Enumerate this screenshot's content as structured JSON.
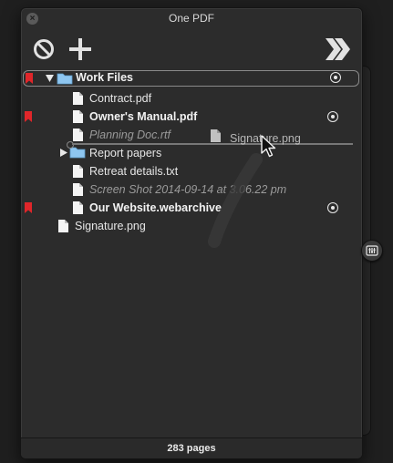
{
  "window": {
    "title": "One PDF"
  },
  "toolbar": {
    "remove": "prohibit-icon",
    "add": "plus-icon",
    "forward": "double-chevron-icon"
  },
  "items": [
    {
      "label": "Work Files",
      "type": "folder",
      "bold": true,
      "bookmarked": true,
      "expanded": true,
      "radio": true
    },
    {
      "label": "Contract.pdf",
      "type": "file"
    },
    {
      "label": "Owner's Manual.pdf",
      "type": "file",
      "bold": true,
      "bookmarked": true,
      "radio": true
    },
    {
      "label": "Planning Doc.rtf",
      "type": "file",
      "italic": true
    },
    {
      "label": "Report papers",
      "type": "folder",
      "expanded": false
    },
    {
      "label": "Retreat details.txt",
      "type": "file"
    },
    {
      "label": "Screen Shot 2014-09-14 at 3.06.22 pm",
      "type": "file",
      "italic": true
    },
    {
      "label": "Our Website.webarchive",
      "type": "file",
      "bold": true,
      "bookmarked": true,
      "radio": true
    },
    {
      "label": "Signature.png",
      "type": "file"
    }
  ],
  "drag": {
    "label": "Signature.png"
  },
  "footer": {
    "pages": "283 pages"
  },
  "colors": {
    "bookmark": "#e0262a",
    "folder": "#8ec6f0",
    "background": "#2c2c2c"
  }
}
